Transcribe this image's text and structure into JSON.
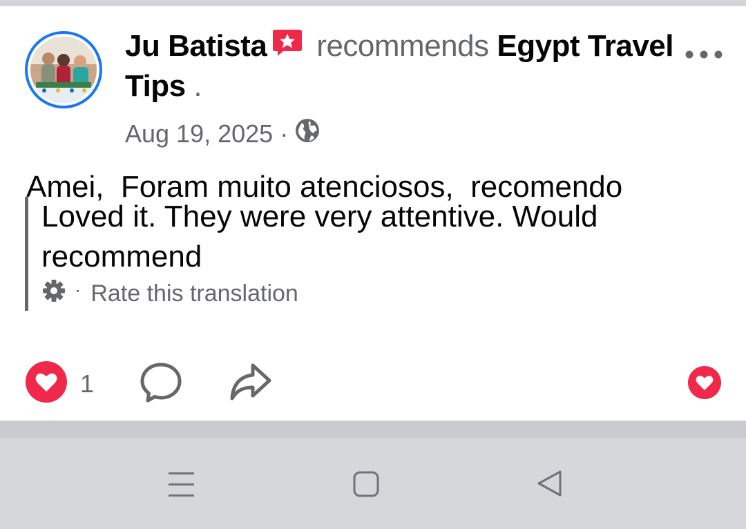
{
  "post": {
    "author": "Ju Batista",
    "verb": "recommends",
    "page_name": "Egypt Travel Tips",
    "trailing": ".",
    "date": "Aug 19, 2025",
    "separator": "·",
    "audience_icon": "globe-icon",
    "original_text": "Amei,  Foram muito atenciosos,  recomendo",
    "translation": "Loved it. They were very attentive. Would recommend",
    "rate_dot": "·",
    "rate_label": "Rate this translation"
  },
  "footer": {
    "reaction_count": "1",
    "reaction_icon": "love-reaction-icon",
    "comment_icon": "comment-icon",
    "share_icon": "share-icon"
  },
  "navbar": {
    "menu_icon": "menu-icon",
    "home_icon": "home-square-icon",
    "back_icon": "back-triangle-icon"
  },
  "colors": {
    "accent": "#1877f2",
    "love": "#f0284a",
    "secondary_text": "#65676b",
    "navbar_bg": "#d6d7db"
  }
}
